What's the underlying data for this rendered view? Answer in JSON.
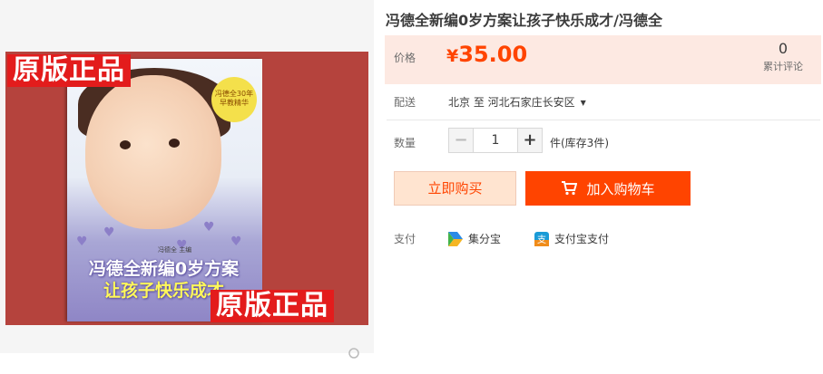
{
  "product": {
    "title": "冯德全新编0岁方案让孩子快乐成才/冯德全",
    "image": {
      "stamp_top": "原版正品",
      "stamp_bottom": "原版正品",
      "badge": "冯德全30年早教精华",
      "cover_title": "冯德全新编0岁方案",
      "cover_subtitle": "让孩子快乐成才",
      "cover_author": "冯德全 主编"
    }
  },
  "price": {
    "label": "价格",
    "currency": "¥",
    "value": "35.00",
    "accent_color": "#ff4400"
  },
  "reviews": {
    "count": "0",
    "label": "累计评论"
  },
  "shipping": {
    "label": "配送",
    "text": "北京 至  河北石家庄长安区"
  },
  "quantity": {
    "label": "数量",
    "minus": "−",
    "value": "1",
    "plus": "+",
    "stock": "件(库存3件)"
  },
  "actions": {
    "buy_now": "立即购买",
    "add_to_cart": "加入购物车"
  },
  "payment": {
    "label": "支付",
    "methods": [
      {
        "name": "集分宝",
        "icon": "jifenbao-icon"
      },
      {
        "name": "支付宝支付",
        "icon": "alipay-icon"
      }
    ]
  }
}
